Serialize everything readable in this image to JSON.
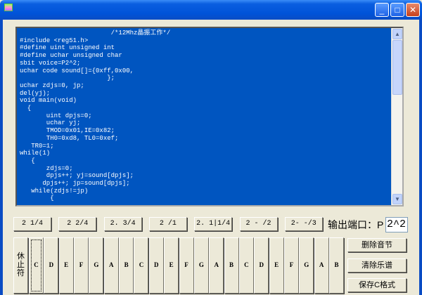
{
  "editor": {
    "lines": [
      "                        /*12Mhz晶振工作*/",
      "#include <reg51.h>",
      "#define uint unsigned int",
      "#define uchar unsigned char",
      "sbit voice=P2^2;",
      "uchar code sound[]={0xff,0x00,",
      "                       };",
      "uchar zdjs=0, jp;",
      "del(yj);",
      "void main(void)",
      "  {",
      "       uint dpjs=0;",
      "       uchar yj;",
      "       TMOD=0x01,IE=0x82;",
      "       TH0=0xd8, TL0=0xef;",
      "   TR0=1;",
      "while(1)",
      "   {",
      "       zdjs=0;",
      "       dpjs++; yj=sound[dpjs];",
      "      dpjs++; jp=sound[dpjs];",
      "   while(zdjs!=jp)",
      "        {"
    ]
  },
  "durations": [
    "2  1/4",
    "2  2/4",
    "2.  3/4",
    "2   /1",
    "2. 1|1/4",
    "2 - /2",
    "2- -/3"
  ],
  "port": {
    "label": "输出端口：P",
    "value": "2^2"
  },
  "keys": {
    "rest": "休止符",
    "notes": [
      "C",
      "D",
      "E",
      "F",
      "G",
      "A",
      "B",
      "C",
      "D",
      "E",
      "F",
      "G",
      "A",
      "B",
      "C",
      "D",
      "E",
      "F",
      "G",
      "A",
      "B"
    ]
  },
  "actions": {
    "delete": "删除音节",
    "clear": "清除乐谱",
    "save": "保存C格式"
  }
}
